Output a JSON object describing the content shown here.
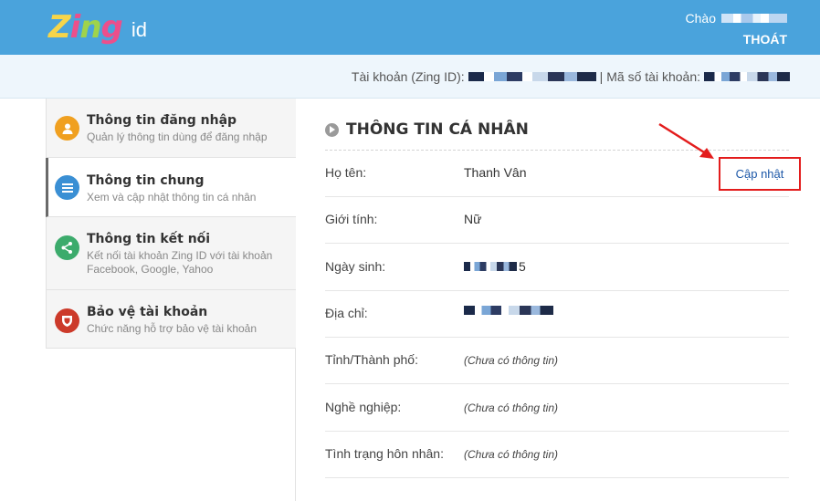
{
  "header": {
    "logo_text": "Zing",
    "logo_suffix": "id",
    "greeting": "Chào",
    "logout_label": "THOÁT"
  },
  "account_bar": {
    "zing_id_label": "Tài khoản (Zing ID):",
    "separator": "|",
    "account_number_label": "Mã số tài khoản:"
  },
  "sidebar": {
    "items": [
      {
        "title": "Thông tin đăng nhập",
        "desc": "Quản lý thông tin dùng để đăng nhập",
        "icon": "user-icon",
        "color": "#f0a020"
      },
      {
        "title": "Thông tin chung",
        "desc": "Xem và cập nhật thông tin cá nhân",
        "icon": "list-icon",
        "color": "#3a8fd4"
      },
      {
        "title": "Thông tin kết nối",
        "desc": "Kết nối tài khoản Zing ID với tài khoản Facebook, Google, Yahoo",
        "icon": "share-icon",
        "color": "#3cab6c"
      },
      {
        "title": "Bảo vệ tài khoản",
        "desc": "Chức năng hỗ trợ bảo vệ tài khoản",
        "icon": "shield-icon",
        "color": "#cc3a2a"
      }
    ]
  },
  "main": {
    "section_title": "THÔNG TIN CÁ NHÂN",
    "update_label": "Cập nhật",
    "rows": [
      {
        "label": "Họ tên:",
        "value": "Thanh Vân"
      },
      {
        "label": "Giới tính:",
        "value": "Nữ"
      },
      {
        "label": "Ngày sinh:",
        "value": "5"
      },
      {
        "label": "Địa chỉ:",
        "value": ""
      },
      {
        "label": "Tỉnh/Thành phố:",
        "value": "(Chưa có thông tin)"
      },
      {
        "label": "Nghề nghiệp:",
        "value": "(Chưa có thông tin)"
      },
      {
        "label": "Tình trạng hôn nhân:",
        "value": "(Chưa có thông tin)"
      }
    ]
  },
  "colors": {
    "header_bg": "#4aa3dc",
    "highlight_red": "#e31c1c",
    "link_blue": "#1d58a8"
  }
}
